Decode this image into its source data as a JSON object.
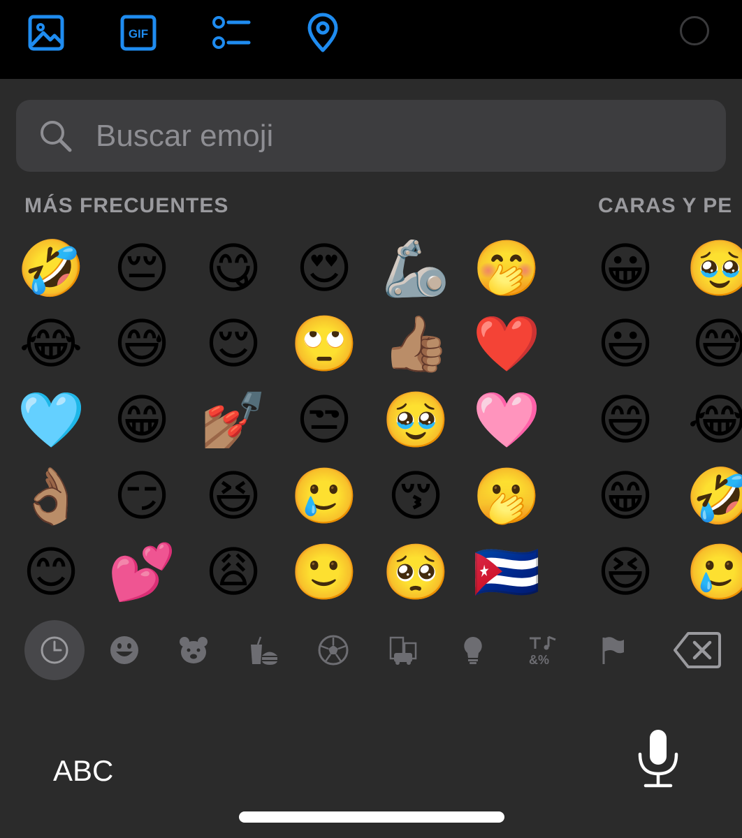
{
  "toolbar": {
    "icons": [
      "image-icon",
      "gif-icon",
      "checklist-icon",
      "location-pin-icon",
      "radio-circle-icon"
    ],
    "gif_label": "GIF",
    "accent": "#1f8cf0"
  },
  "search": {
    "placeholder": "Buscar emoji"
  },
  "sections": {
    "frequent_title": "MÁS FRECUENTES",
    "faces_title": "CARAS Y PE"
  },
  "frequent_emojis": [
    [
      "🤣",
      "😔",
      "😋",
      "😍",
      "🦾",
      "🤭"
    ],
    [
      "😂",
      "😅",
      "😌",
      "🙄",
      "👍🏽",
      "❤️"
    ],
    [
      "🩵",
      "😁",
      "💅🏽",
      "😒",
      "🥹",
      "🩷"
    ],
    [
      "👌🏽",
      "😏",
      "😆",
      "🥲",
      "😚",
      "🫢"
    ],
    [
      "😊",
      "💕",
      "😩",
      "🙂",
      "🥺",
      "🇨🇺"
    ]
  ],
  "faces_emojis": [
    [
      "😀",
      "🥹"
    ],
    [
      "😃",
      "😅"
    ],
    [
      "😄",
      "😂"
    ],
    [
      "😁",
      "🤣"
    ],
    [
      "😆",
      "🥲"
    ]
  ],
  "categories": [
    "recent-clock-icon",
    "smiley-icon",
    "animal-bear-icon",
    "food-icon",
    "sports-ball-icon",
    "travel-car-icon",
    "objects-lightbulb-icon",
    "symbols-icon",
    "flag-icon"
  ],
  "active_category": "recent-clock-icon",
  "bottom": {
    "abc_label": "ABC"
  }
}
